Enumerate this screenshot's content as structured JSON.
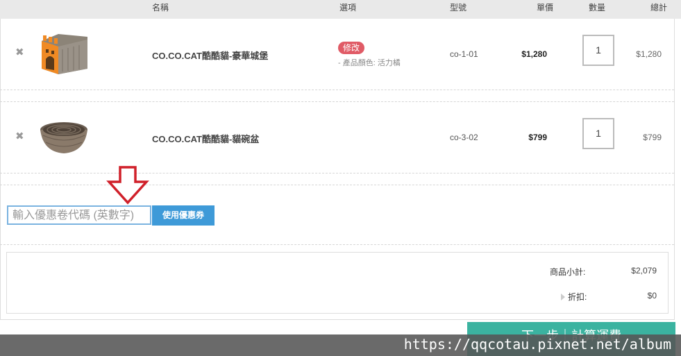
{
  "columns": {
    "name": "名稱",
    "option": "選項",
    "sku": "型號",
    "unit_price": "單價",
    "quantity": "數量",
    "total": "總計"
  },
  "items": [
    {
      "remove_icon": "✖",
      "image_name": "cat-castle-image",
      "name": "CO.CO.CAT酷酷貓-豪華城堡",
      "edit_label": "修改",
      "option_text": "- 產品顏色: 活力橘",
      "sku": "co-1-01",
      "unit_price": "$1,280",
      "quantity": "1",
      "total": "$1,280"
    },
    {
      "remove_icon": "✖",
      "image_name": "cat-bowl-image",
      "name": "CO.CO.CAT酷酷貓-貓碗盆",
      "sku": "co-3-02",
      "unit_price": "$799",
      "quantity": "1",
      "total": "$799"
    }
  ],
  "coupon": {
    "placeholder": "輸入優惠卷代碼 (英數字)",
    "button_label": "使用優惠券"
  },
  "summary": {
    "subtotal_label": "商品小計:",
    "subtotal_value": "$2,079",
    "discount_label": "折扣:",
    "discount_value": "$0"
  },
  "next_button": "下一步｜計算運費",
  "watermark": "https://qqcotau.pixnet.net/album",
  "colors": {
    "header_bg": "#e9e9e9",
    "edit_badge": "#e05b66",
    "coupon_button": "#3e9ad8",
    "next_button": "#3bb3a0",
    "annotation_arrow": "#d0202a"
  }
}
